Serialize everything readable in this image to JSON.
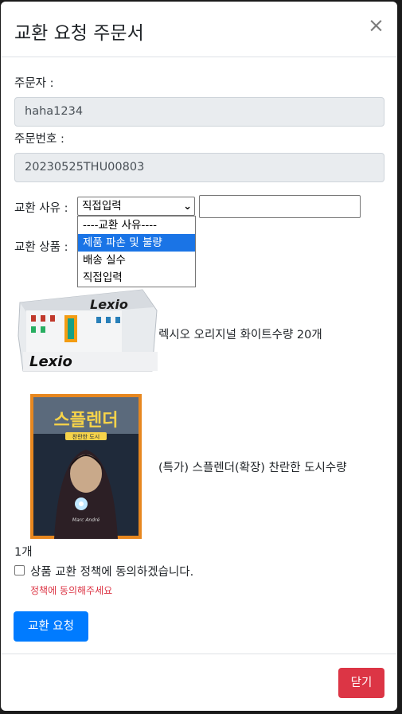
{
  "modal": {
    "title": "교환 요청 주문서",
    "close_symbol": "×"
  },
  "form": {
    "orderer_label": "주문자 :",
    "orderer_value": "haha1234",
    "order_no_label": "주문번호 :",
    "order_no_value": "20230525THU00803",
    "reason_label": "교환 사유 :",
    "reason_selected": "직접입력",
    "reason_options": [
      "----교환 사유----",
      "제품 파손 및 불량",
      "배송 실수",
      "직접입력"
    ],
    "reason_text_value": "",
    "products_label": "교환 상품 :"
  },
  "products": [
    {
      "name": "렉시오 오리지널 화이트수량 20개",
      "image": "lexio-box-image"
    },
    {
      "name": "(특가) 스플렌더(확장) 찬란한 도시수량",
      "name_wrap": "1개",
      "image": "splendor-box-image"
    }
  ],
  "agreement": {
    "checked": false,
    "label": "상품 교환 정책에 동의하겠습니다.",
    "warning": "정책에 동의해주세요",
    "warning_color": "#dc3545"
  },
  "buttons": {
    "request": "교환 요청",
    "close": "닫기"
  },
  "colors": {
    "primary": "#007bff",
    "danger": "#dc3545",
    "highlight": "#1a74e6"
  }
}
